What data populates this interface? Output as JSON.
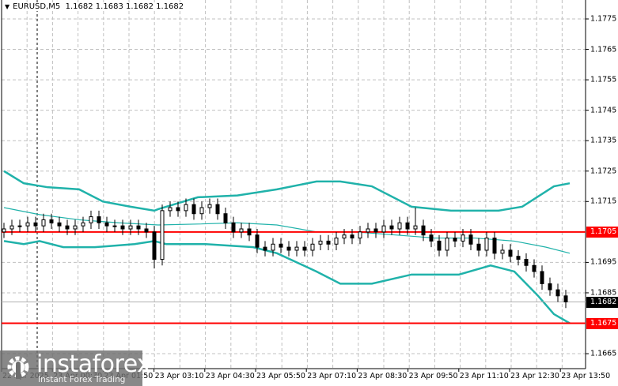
{
  "header": {
    "symbol": "EURUSD,M5",
    "ohlc": "1.1682 1.1683 1.1682 1.1682"
  },
  "colors": {
    "band": "#20b2aa",
    "level": "#ff0000",
    "current": "#000000",
    "grid": "#c0c0c0"
  },
  "watermark": {
    "brand": "instaforex",
    "tagline": "Instant Forex Trading"
  },
  "chart_data": {
    "type": "candlestick",
    "title": "EURUSD,M5",
    "price_ticks": [
      "1.1775",
      "1.1765",
      "1.1755",
      "1.1745",
      "1.1735",
      "1.1725",
      "1.1715",
      "1.1695",
      "1.1685",
      "1.1665"
    ],
    "price_range": [
      1.1661,
      1.1781
    ],
    "time_labels": [
      "22 Apr 2025",
      "23 Apr 00:30",
      "23 Apr 01:50",
      "23 Apr 03:10",
      "23 Apr 04:30",
      "23 Apr 05:50",
      "23 Apr 07:10",
      "23 Apr 08:30",
      "23 Apr 09:50",
      "23 Apr 11:10",
      "23 Apr 12:30",
      "23 Apr 13:50"
    ],
    "levels": [
      {
        "price": 1.1705,
        "label": "1.1705"
      },
      {
        "price": 1.1675,
        "label": "1.1675"
      }
    ],
    "current": {
      "price": 1.1682,
      "label": "1.1682"
    },
    "closes": [
      1.1706,
      1.1707,
      1.1707,
      1.1708,
      1.1707,
      1.1709,
      1.1708,
      1.1707,
      1.1706,
      1.1707,
      1.1708,
      1.171,
      1.1708,
      1.1707,
      1.1707,
      1.1706,
      1.1707,
      1.1706,
      1.1705,
      1.1696,
      1.1712,
      1.1713,
      1.1712,
      1.1714,
      1.1711,
      1.1713,
      1.1714,
      1.1711,
      1.1708,
      1.1705,
      1.1706,
      1.1704,
      1.17,
      1.1699,
      1.1701,
      1.17,
      1.1699,
      1.17,
      1.1699,
      1.1701,
      1.1702,
      1.1701,
      1.1703,
      1.1704,
      1.1703,
      1.1705,
      1.1706,
      1.1705,
      1.1707,
      1.1706,
      1.1708,
      1.1706,
      1.1707,
      1.1704,
      1.1702,
      1.1699,
      1.1703,
      1.1702,
      1.1704,
      1.1701,
      1.1699,
      1.1703,
      1.1698,
      1.1699,
      1.1697,
      1.1696,
      1.1694,
      1.1692,
      1.1688,
      1.1686,
      1.1684,
      1.1682
    ],
    "bollinger": {
      "upper": [
        [
          0,
          1.1725
        ],
        [
          2.5,
          1.1721
        ],
        [
          5.5,
          1.17197
        ],
        [
          9.5,
          1.1719
        ],
        [
          12.5,
          1.1715
        ],
        [
          16,
          1.17133
        ],
        [
          19,
          1.1712
        ],
        [
          19.5,
          1.17125
        ],
        [
          24.5,
          1.17164
        ],
        [
          29.5,
          1.1717
        ],
        [
          34.5,
          1.1719
        ],
        [
          39.5,
          1.17216
        ],
        [
          42.5,
          1.17216
        ],
        [
          46.5,
          1.172
        ],
        [
          51.5,
          1.17133
        ],
        [
          56.5,
          1.1712
        ],
        [
          62.5,
          1.1712
        ],
        [
          65.5,
          1.17133
        ],
        [
          69.5,
          1.172
        ],
        [
          71.5,
          1.1721
        ]
      ],
      "middle": [
        [
          0,
          1.1713
        ],
        [
          4.5,
          1.17107
        ],
        [
          9.5,
          1.1709
        ],
        [
          14.5,
          1.1708
        ],
        [
          19.5,
          1.17073
        ],
        [
          24.5,
          1.17076
        ],
        [
          29.5,
          1.1708
        ],
        [
          34.5,
          1.17073
        ],
        [
          39.5,
          1.1705
        ],
        [
          44.5,
          1.1705
        ],
        [
          49.5,
          1.1704
        ],
        [
          54.5,
          1.1703
        ],
        [
          59.5,
          1.1703
        ],
        [
          64.5,
          1.1702
        ],
        [
          68.5,
          1.17
        ],
        [
          71.5,
          1.1698
        ]
      ],
      "lower": [
        [
          0,
          1.1702
        ],
        [
          2.5,
          1.1701
        ],
        [
          4.5,
          1.1702
        ],
        [
          7.5,
          1.17
        ],
        [
          11.5,
          1.17
        ],
        [
          16.5,
          1.1701
        ],
        [
          19,
          1.1702
        ],
        [
          20.5,
          1.1701
        ],
        [
          25.5,
          1.1701
        ],
        [
          31.5,
          1.17
        ],
        [
          34.5,
          1.1698
        ],
        [
          39.5,
          1.1692
        ],
        [
          42.5,
          1.1688
        ],
        [
          46.5,
          1.1688
        ],
        [
          51.5,
          1.1691
        ],
        [
          54.5,
          1.1691
        ],
        [
          57.5,
          1.1691
        ],
        [
          61.5,
          1.1694
        ],
        [
          64.5,
          1.1692
        ],
        [
          67.5,
          1.1684
        ],
        [
          69.5,
          1.1678
        ],
        [
          71.5,
          1.1675
        ]
      ]
    }
  }
}
